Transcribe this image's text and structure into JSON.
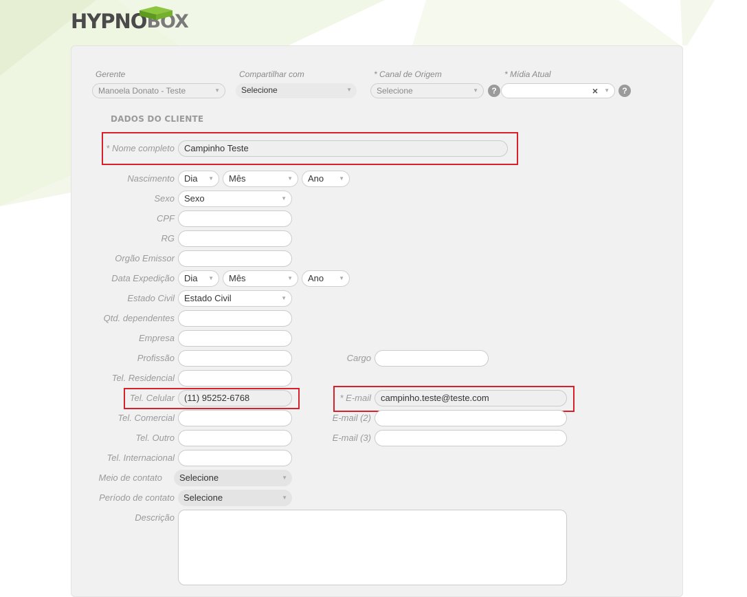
{
  "brand": {
    "part1": "HYPNO",
    "part2": "BOX"
  },
  "top_fields": {
    "gerente": {
      "label": "Gerente",
      "value": "Manoela Donato - Teste"
    },
    "compartilhar": {
      "label": "Compartilhar com",
      "value": "Selecione"
    },
    "canal": {
      "label": "* Canal de Origem",
      "value": "Selecione"
    },
    "midia": {
      "label": "* Mídia Atual",
      "value": ""
    }
  },
  "help_glyph": "?",
  "clear_glyph": "×",
  "section_title": "DADOS DO CLIENTE",
  "form": {
    "nome": {
      "label": "* Nome completo",
      "value": "Campinho Teste"
    },
    "nascimento": {
      "label": "Nascimento",
      "dia": "Dia",
      "mes": "Mês",
      "ano": "Ano"
    },
    "sexo": {
      "label": "Sexo",
      "value": "Sexo"
    },
    "cpf": {
      "label": "CPF",
      "value": ""
    },
    "rg": {
      "label": "RG",
      "value": ""
    },
    "orgao": {
      "label": "Orgão Emissor",
      "value": ""
    },
    "expedicao": {
      "label": "Data Expedição",
      "dia": "Dia",
      "mes": "Mês",
      "ano": "Ano"
    },
    "estado_civil": {
      "label": "Estado Civil",
      "value": "Estado Civil"
    },
    "dependentes": {
      "label": "Qtd. dependentes",
      "value": ""
    },
    "empresa": {
      "label": "Empresa",
      "value": ""
    },
    "profissao": {
      "label": "Profissão",
      "value": ""
    },
    "cargo": {
      "label": "Cargo",
      "value": ""
    },
    "tel_residencial": {
      "label": "Tel. Residencial",
      "value": ""
    },
    "tel_celular": {
      "label": "Tel. Celular",
      "value": "(11) 95252-6768"
    },
    "email": {
      "label": "* E-mail",
      "value": "campinho.teste@teste.com"
    },
    "tel_comercial": {
      "label": "Tel. Comercial",
      "value": ""
    },
    "email2": {
      "label": "E-mail (2)",
      "value": ""
    },
    "tel_outro": {
      "label": "Tel. Outro",
      "value": ""
    },
    "email3": {
      "label": "E-mail (3)",
      "value": ""
    },
    "tel_internacional": {
      "label": "Tel. Internacional",
      "value": ""
    },
    "meio_contato": {
      "label": "Meio de contato",
      "value": "Selecione"
    },
    "periodo_contato": {
      "label": "Período de contato",
      "value": "Selecione"
    },
    "descricao": {
      "label": "Descrição",
      "value": ""
    }
  },
  "colors": {
    "highlight": "#d9202a",
    "section_bg": "#dedede",
    "panel_bg": "#f1f1f1"
  }
}
